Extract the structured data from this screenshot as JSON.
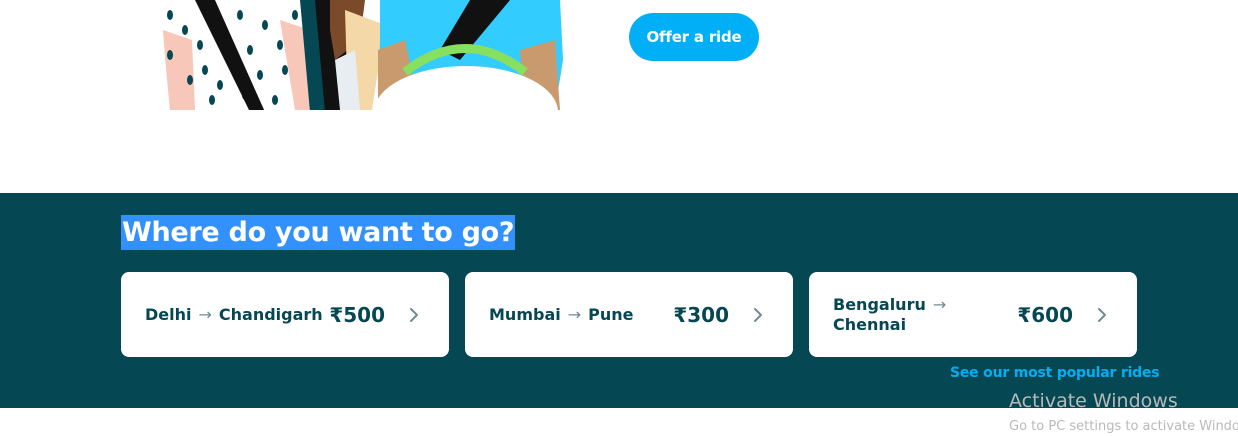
{
  "hero": {
    "offer_button_label": "Offer a ride"
  },
  "destinations": {
    "title": "Where do you want to go?",
    "routes": [
      {
        "from": "Delhi",
        "to": "Chandigarh",
        "price": "₹500"
      },
      {
        "from": "Mumbai",
        "to": "Pune",
        "price": "₹300"
      },
      {
        "from": "Bengaluru",
        "to": "Chennai",
        "price": "₹600"
      }
    ],
    "popular_link": "See our most popular rides"
  },
  "icons": {
    "arrow": "arrow-right-icon",
    "chevron": "chevron-right-icon"
  },
  "colors": {
    "brand_teal": "#054752",
    "accent_blue": "#00aff5",
    "selection_highlight": "#3390ff"
  },
  "watermark": {
    "title": "Activate Windows",
    "subtitle": "Go to PC settings to activate Windows."
  }
}
